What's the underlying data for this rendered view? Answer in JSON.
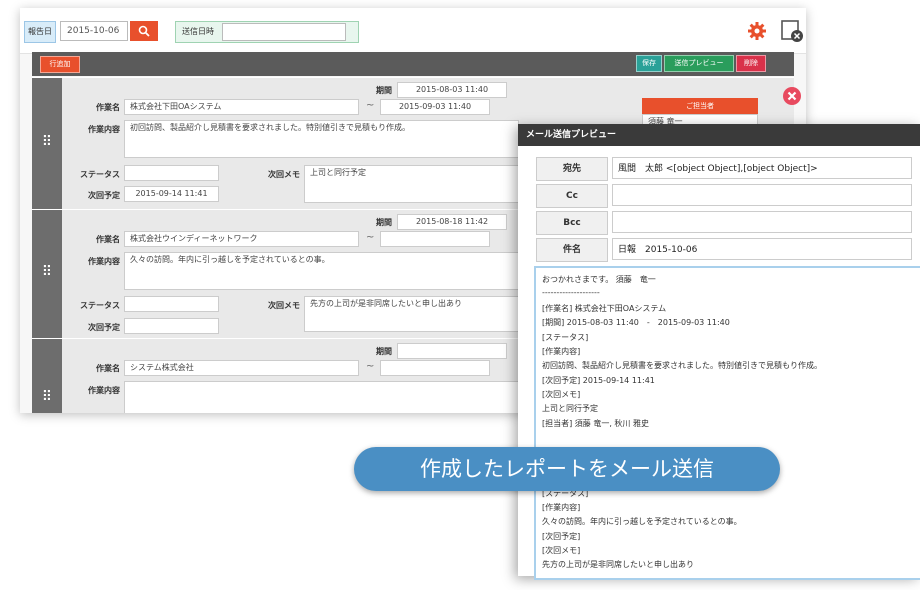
{
  "topbar": {
    "report_date_label": "報告日",
    "report_date_value": "2015-10-06",
    "search_icon": "search-icon",
    "send_datetime_label": "送信日時",
    "send_datetime_value": "",
    "settings_icon": "gear-icon",
    "window_icon": "close-window-icon"
  },
  "toolbar": {
    "add_row_label": "行追加",
    "save_label": "保存",
    "send_preview_label": "送信プレビュー",
    "delete_label": "削除"
  },
  "labels": {
    "period": "期間",
    "task_name": "作業名",
    "task_content": "作業内容",
    "status": "ステータス",
    "next_memo": "次回メモ",
    "next_schedule": "次回予定",
    "tilde": "~"
  },
  "rows": [
    {
      "period_start": "2015-08-03 11:40",
      "period_end": "2015-09-03 11:40",
      "task_name": "株式会社下田OAシステム",
      "task_content": "初回訪問、製品紹介し見積書を要求されました。特別値引きで見積もり作成。",
      "status": "",
      "next_memo": "上司と同行予定",
      "next_schedule": "2015-09-14 11:41"
    },
    {
      "period_start": "2015-08-18 11:42",
      "period_end": "",
      "task_name": "株式会社ウインディーネットワーク",
      "task_content": "久々の訪問。年内に引っ越しを予定されているとの事。",
      "status": "",
      "next_memo": "先方の上司が是非同席したいと申し出あり",
      "next_schedule": ""
    },
    {
      "period_start": "",
      "period_end": "",
      "task_name": "システム株式会社",
      "task_content": ""
    }
  ],
  "assignee_panel": {
    "header": "ご担当者",
    "first": "須藤 竜一",
    "close_icon": "close-icon"
  },
  "preview": {
    "title": "メール送信プレビュー",
    "to_label": "宛先",
    "to_value": "風間　太郎 <[object Object],[object Object]>",
    "cc_label": "Cc",
    "cc_value": "",
    "bcc_label": "Bcc",
    "bcc_value": "",
    "subject_label": "件名",
    "subject_value": "日報　2015-10-06",
    "body_lines": [
      "おつかれさまです。 須藤　竜一",
      "--------------------",
      "[作業名] 株式会社下田OAシステム",
      "[期間] 2015-08-03 11:40　-　2015-09-03 11:40",
      "[ステータス]",
      "[作業内容]",
      "初回訪問、製品紹介し見積書を要求されました。特別値引きで見積もり作成。",
      "[次回予定] 2015-09-14 11:41",
      "[次回メモ]",
      "上司と同行予定",
      "[担当者] 須藤 竜一, 秋川 雅史"
    ],
    "body_lines_lower": [
      "[ステータス]",
      "[作業内容]",
      "久々の訪問。年内に引っ越しを予定されているとの事。",
      "[次回予定]",
      "[次回メモ]",
      "先方の上司が是非同席したいと申し出あり"
    ]
  },
  "banner": {
    "text": "作成したレポートをメール送信"
  },
  "colors": {
    "accent_orange": "#e8502c",
    "save_green": "#2a9d5c",
    "preview_teal": "#2aa198",
    "delete_red": "#d9314a",
    "banner_blue": "#4a8fc4"
  }
}
